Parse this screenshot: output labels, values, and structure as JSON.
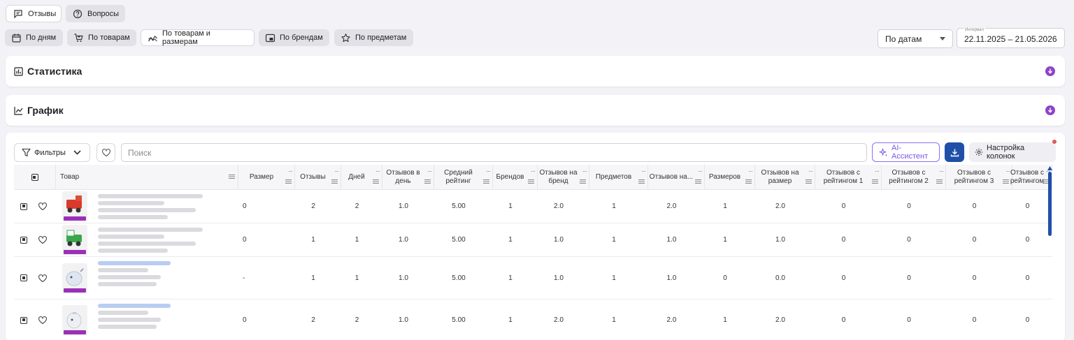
{
  "tabs": [
    {
      "label": "Отзывы",
      "active": true,
      "icon": "message-square-icon"
    },
    {
      "label": "Вопросы",
      "active": false,
      "icon": "help-circle-icon"
    }
  ],
  "views": [
    {
      "label": "По дням",
      "active": false,
      "icon": "calendar-icon"
    },
    {
      "label": "По товарам",
      "active": false,
      "icon": "cart-icon"
    },
    {
      "label": "По товарам и размерам",
      "active": true,
      "icon": "trend-lines-icon"
    },
    {
      "label": "По брендам",
      "active": false,
      "icon": "image-frame-icon"
    },
    {
      "label": "По предметам",
      "active": false,
      "icon": "star-icon"
    }
  ],
  "date_mode": {
    "value": "По датам"
  },
  "interval": {
    "label": "Интервал",
    "value": "22.11.2025 – 21.05.2026"
  },
  "panels": {
    "stats": {
      "title": "Статистика",
      "icon": "bar-chart-icon"
    },
    "chart": {
      "title": "График",
      "icon": "line-chart-icon"
    }
  },
  "toolbar": {
    "filters_label": "Фильтры",
    "search_placeholder": "Поиск",
    "ai_label": "AI-Ассистент",
    "columns_label": "Настройка колонок"
  },
  "colors": {
    "accent": "#7b55e8",
    "primary": "#1f4fa8",
    "panel_chevron": "#8e44c9",
    "tag": "#9b2fb8"
  },
  "table": {
    "columns": [
      {
        "key": "product",
        "label": "Товар"
      },
      {
        "key": "size",
        "label": "Размер"
      },
      {
        "key": "reviews",
        "label": "Отзывы"
      },
      {
        "key": "days",
        "label": "Дней"
      },
      {
        "key": "per_day",
        "label": "Отзывов в день"
      },
      {
        "key": "avg_rating",
        "label": "Средний рейтинг"
      },
      {
        "key": "brands",
        "label": "Брендов"
      },
      {
        "key": "per_brand",
        "label": "Отзывов на бренд"
      },
      {
        "key": "subjects",
        "label": "Предметов"
      },
      {
        "key": "per_subject",
        "label": "Отзывов на..."
      },
      {
        "key": "sizes",
        "label": "Размеров"
      },
      {
        "key": "per_size",
        "label": "Отзывов на размер"
      },
      {
        "key": "r1",
        "label": "Отзывов с рейтингом 1"
      },
      {
        "key": "r2",
        "label": "Отзывов с рейтингом 2"
      },
      {
        "key": "r3",
        "label": "Отзывов с рейтингом 3"
      },
      {
        "key": "r4",
        "label": "Отзывов с рейтингом"
      }
    ],
    "rows": [
      {
        "size": "0",
        "reviews": "2",
        "days": "2",
        "per_day": "1.0",
        "avg_rating": "5.00",
        "brands": "1",
        "per_brand": "2.0",
        "subjects": "1",
        "per_subject": "2.0",
        "sizes": "1",
        "per_size": "2.0",
        "r1": "0",
        "r2": "0",
        "r3": "0",
        "r4": "0"
      },
      {
        "size": "0",
        "reviews": "1",
        "days": "1",
        "per_day": "1.0",
        "avg_rating": "5.00",
        "brands": "1",
        "per_brand": "1.0",
        "subjects": "1",
        "per_subject": "1.0",
        "sizes": "1",
        "per_size": "1.0",
        "r1": "0",
        "r2": "0",
        "r3": "0",
        "r4": "0"
      },
      {
        "size": "-",
        "reviews": "1",
        "days": "1",
        "per_day": "1.0",
        "avg_rating": "5.00",
        "brands": "1",
        "per_brand": "1.0",
        "subjects": "1",
        "per_subject": "1.0",
        "sizes": "0",
        "per_size": "0.0",
        "r1": "0",
        "r2": "0",
        "r3": "0",
        "r4": "0"
      },
      {
        "size": "0",
        "reviews": "2",
        "days": "2",
        "per_day": "1.0",
        "avg_rating": "5.00",
        "brands": "1",
        "per_brand": "2.0",
        "subjects": "1",
        "per_subject": "2.0",
        "sizes": "1",
        "per_size": "2.0",
        "r1": "0",
        "r2": "0",
        "r3": "0",
        "r4": "0"
      }
    ]
  }
}
